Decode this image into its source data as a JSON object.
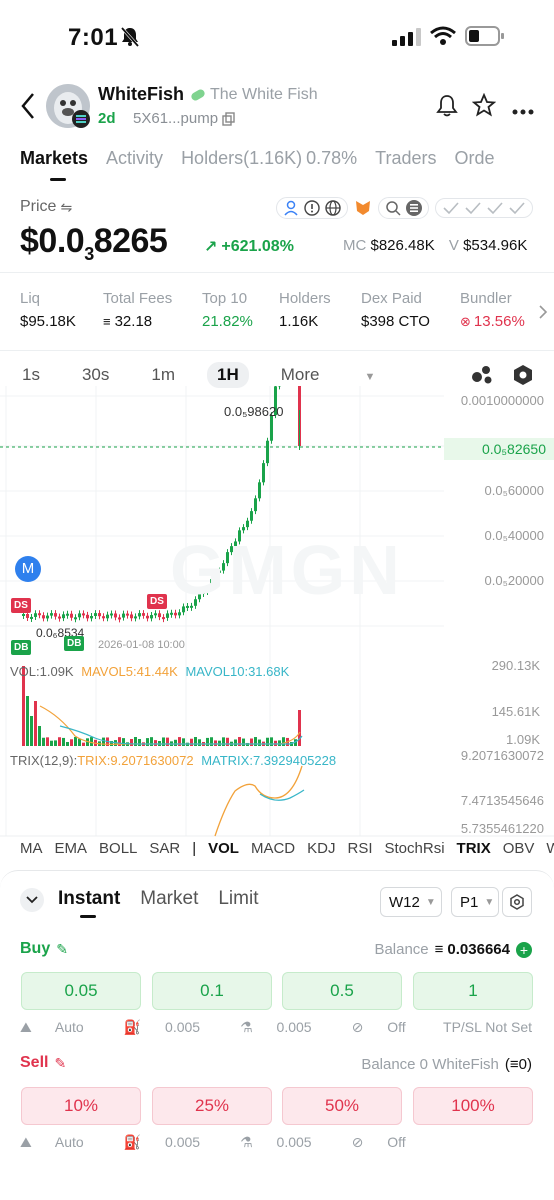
{
  "status": {
    "time": "7:01"
  },
  "header": {
    "name": "WhiteFish",
    "full_name": "The White Fish",
    "age": "2d",
    "address": "5X61...pump"
  },
  "tabs": [
    {
      "label": "Markets",
      "active": true
    },
    {
      "label": "Activity"
    },
    {
      "label": "Holders(1.16K)"
    },
    {
      "label": "0.78%"
    },
    {
      "label": "Traders"
    },
    {
      "label": "Orde"
    }
  ],
  "price": {
    "label": "Price",
    "prefix": "$0.0",
    "sub": "3",
    "suffix": "8265",
    "change": "+621.08%",
    "mc_key": "MC",
    "mc_val": "$826.48K",
    "v_key": "V",
    "v_val": "$534.96K"
  },
  "stats": [
    {
      "label": "Liq",
      "value": "$95.18K"
    },
    {
      "label": "Total Fees",
      "value": "32.18"
    },
    {
      "label": "Top 10",
      "value": "21.82%"
    },
    {
      "label": "Holders",
      "value": "1.16K"
    },
    {
      "label": "Dex Paid",
      "value": "$398 CTO"
    },
    {
      "label": "Bundler",
      "value": "13.56%"
    }
  ],
  "intervals": [
    {
      "label": "1s"
    },
    {
      "label": "30s"
    },
    {
      "label": "1m"
    },
    {
      "label": "1H",
      "active": true
    },
    {
      "label": "More"
    }
  ],
  "chart": {
    "y_labels": [
      "0.0010000000",
      "0.0₅60000",
      "0.0₅40000",
      "0.0₅20000"
    ],
    "current_price": "0.0₅82650",
    "high_label": "0.0₅98620",
    "low_label": "0.0₆8534",
    "date_label": "2026-01-08 10:00",
    "watermark": "GMGN",
    "markers": {
      "m": "M",
      "ds": "DS",
      "db": "DB"
    }
  },
  "vol": {
    "vol": "VOL:1.09K",
    "mavol5": "MAVOL5:41.44K",
    "mavol10": "MAVOL10:31.68K",
    "y1": "290.13K",
    "y2": "145.61K",
    "y3": "1.09K"
  },
  "trix": {
    "label": "TRIX(12,9):",
    "trix": "TRIX:9.2071630072",
    "matrix": "MATRIX:7.3929405228",
    "y1": "9.2071630072",
    "y2": "7.4713545646",
    "y3": "5.7355461220"
  },
  "indicators": [
    "MA",
    "EMA",
    "BOLL",
    "SAR",
    "|",
    "VOL",
    "MACD",
    "KDJ",
    "RSI",
    "StochRsi",
    "TRIX",
    "OBV",
    "WR"
  ],
  "order": {
    "tabs": [
      "Instant",
      "Market",
      "Limit"
    ],
    "wallet": "W12",
    "preset": "P1",
    "buy_label": "Buy",
    "buy_balance_label": "Balance",
    "buy_balance": "0.036664",
    "buy_amounts": [
      "0.05",
      "0.1",
      "0.5",
      "1"
    ],
    "auto": "Auto",
    "fee1": "0.005",
    "fee2": "0.005",
    "off": "Off",
    "tpsl": "TP/SL Not Set",
    "sell_label": "Sell",
    "sell_balance": "Balance 0 WhiteFish",
    "sell_balance_val": "0",
    "sell_amounts": [
      "10%",
      "25%",
      "50%",
      "100%"
    ]
  },
  "colors": {
    "green": "#1aa34a",
    "red": "#e0334d",
    "orange": "#f2a23a",
    "teal": "#38b6c8"
  }
}
